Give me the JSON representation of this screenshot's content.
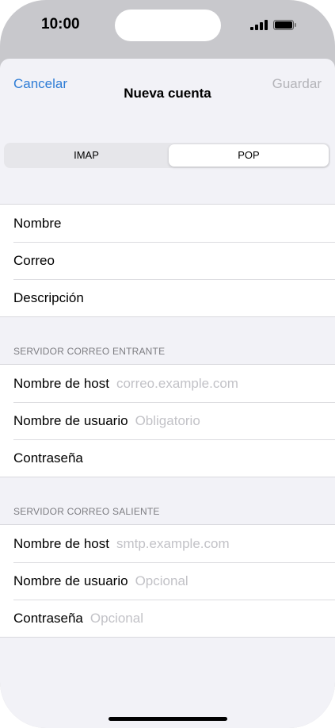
{
  "status_bar": {
    "time": "10:00"
  },
  "nav": {
    "cancel": "Cancelar",
    "title": "Nueva cuenta",
    "save": "Guardar"
  },
  "segmented": {
    "imap": "IMAP",
    "pop": "POP",
    "selected": "POP"
  },
  "account": [
    {
      "label": "Nombre"
    },
    {
      "label": "Correo"
    },
    {
      "label": "Descripción"
    }
  ],
  "incoming": {
    "header": "SERVIDOR CORREO ENTRANTE",
    "rows": [
      {
        "label": "Nombre de host",
        "placeholder": "correo.example.com"
      },
      {
        "label": "Nombre de usuario",
        "placeholder": "Obligatorio"
      },
      {
        "label": "Contraseña",
        "placeholder": ""
      }
    ]
  },
  "outgoing": {
    "header": "SERVIDOR CORREO SALIENTE",
    "rows": [
      {
        "label": "Nombre de host",
        "placeholder": "smtp.example.com"
      },
      {
        "label": "Nombre de usuario",
        "placeholder": "Opcional"
      },
      {
        "label": "Contraseña",
        "placeholder": "Opcional"
      }
    ]
  },
  "colors": {
    "accent": "#2f7dd6",
    "disabled": "#b4b4b9",
    "placeholder": "#c2c2c7",
    "grouped_bg": "#f2f2f7"
  },
  "icons": [
    "signal-icon",
    "battery-icon"
  ]
}
